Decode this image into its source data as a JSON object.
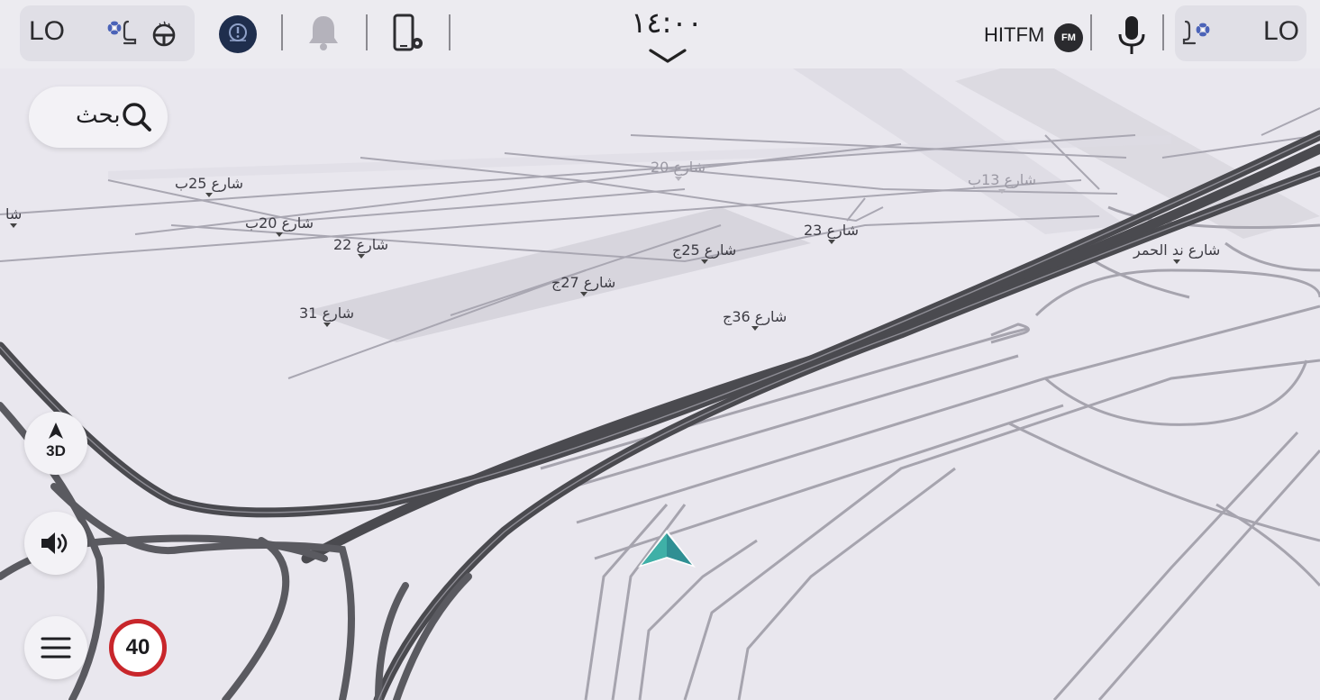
{
  "status_bar": {
    "left_climate_temp": "LO",
    "right_climate_temp": "LO",
    "clock": "١٤:٠٠",
    "radio_station": "HITFM",
    "radio_band": "FM"
  },
  "map": {
    "streets": [
      {
        "id": "s25b",
        "label": "شارع 25ب"
      },
      {
        "id": "s20",
        "label": "شارع 20"
      },
      {
        "id": "s20b",
        "label": "شارع 20ب"
      },
      {
        "id": "s13b",
        "label": "شارع 13ب"
      },
      {
        "id": "s22",
        "label": "شارع 22"
      },
      {
        "id": "s23",
        "label": "شارع 23"
      },
      {
        "id": "s25j",
        "label": "شارع 25ج"
      },
      {
        "id": "s27j",
        "label": "شارع 27ج"
      },
      {
        "id": "s31",
        "label": "شارع 31"
      },
      {
        "id": "s36j",
        "label": "شارع 36ج"
      },
      {
        "id": "nadalhamar",
        "label": "شارع ند الحمر"
      },
      {
        "id": "edge",
        "label": "شا"
      }
    ]
  },
  "controls": {
    "search_label": "بحث",
    "view_mode_label": "3D",
    "speed_limit": "40"
  },
  "colors": {
    "speed_ring": "#c8262b",
    "road_dark": "#4a4a4f",
    "road_light": "#9a99a2",
    "vehicle_arrow": "#2f8f93"
  },
  "icons": [
    "fan-seat-icon",
    "steering-heat-icon",
    "parking-brake-icon",
    "bell-icon",
    "phone-settings-icon",
    "chevron-down-icon",
    "microphone-icon",
    "search-icon",
    "compass-icon",
    "volume-icon",
    "menu-icon",
    "vehicle-position-icon"
  ]
}
